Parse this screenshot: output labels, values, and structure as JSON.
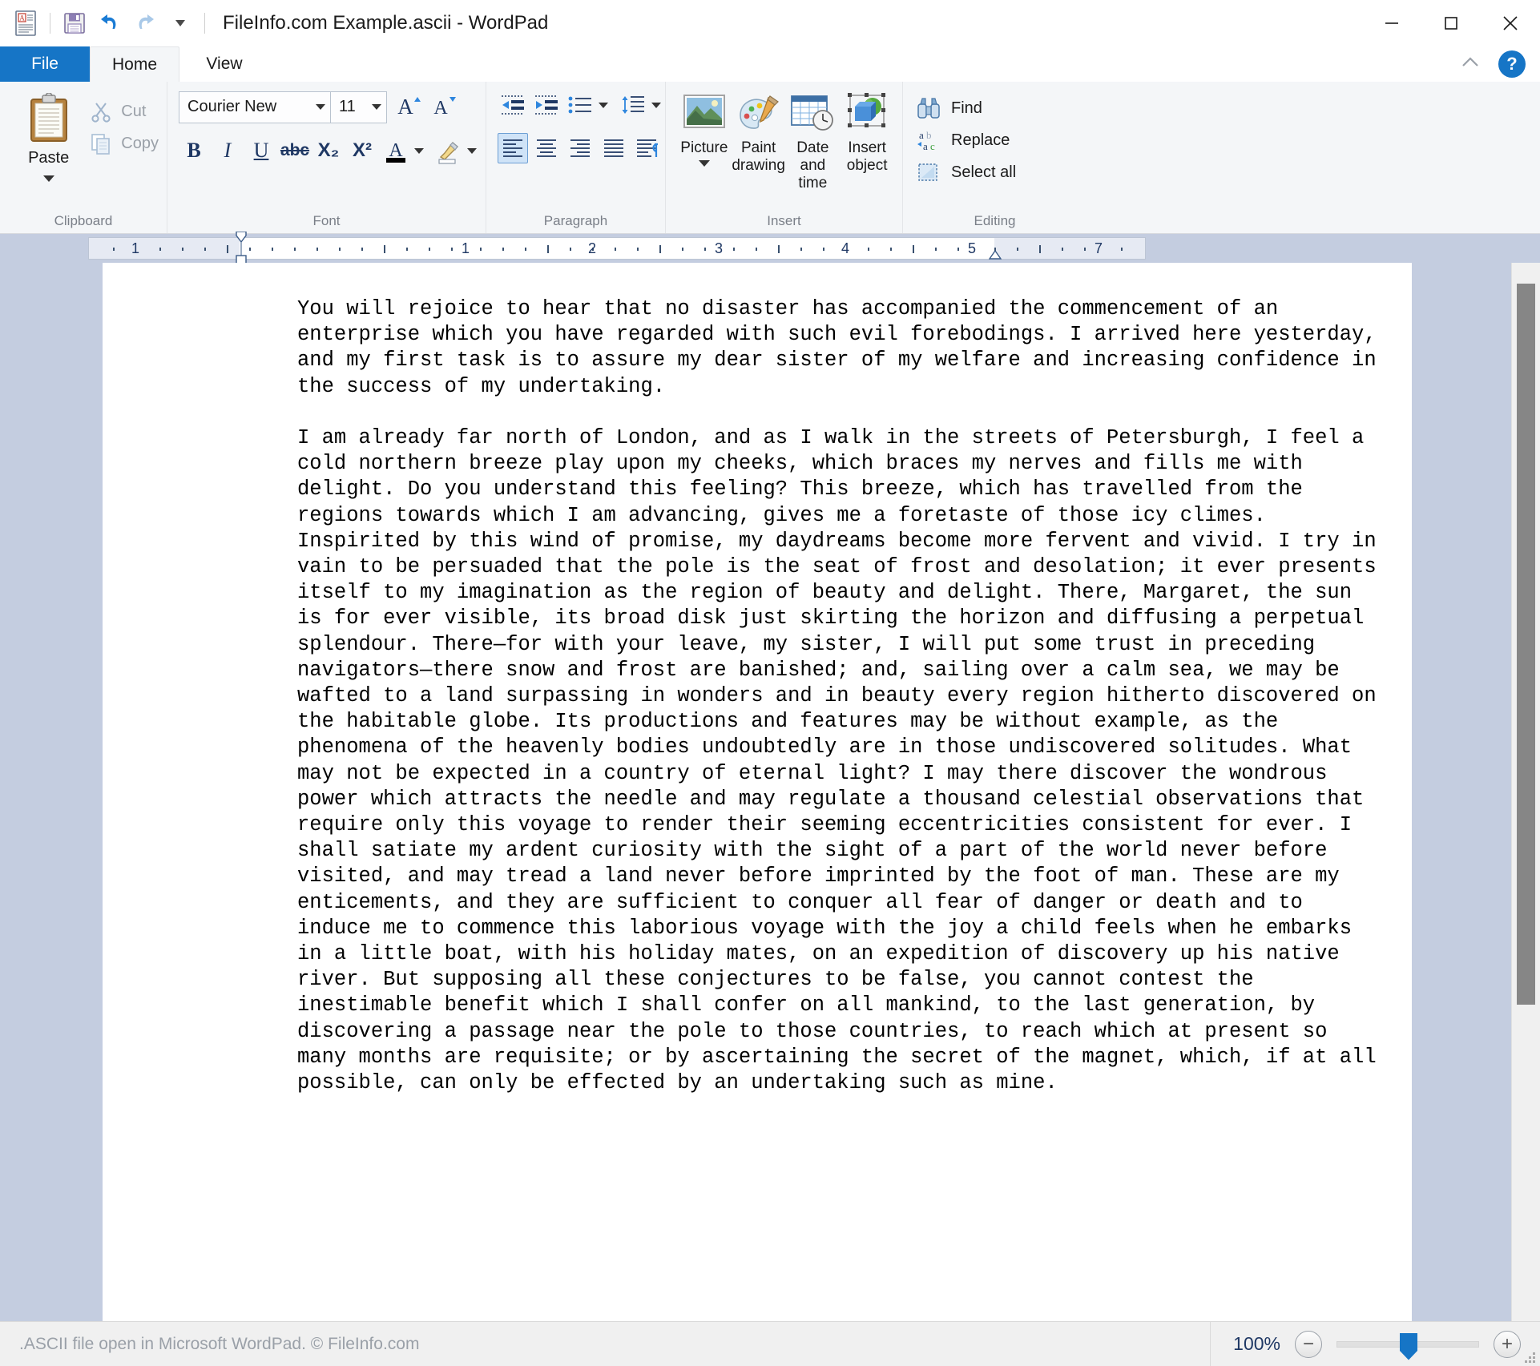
{
  "window": {
    "title": "FileInfo.com Example.ascii - WordPad",
    "app_icon": "document-app-icon",
    "minimize_label": "—",
    "maximize_label": "□",
    "close_label": "✕"
  },
  "quick_access": {
    "save_label": "save-icon",
    "undo_label": "undo-icon",
    "redo_label": "redo-icon",
    "customize_label": "▾"
  },
  "tabs": [
    {
      "label": "File",
      "active": false,
      "type": "file"
    },
    {
      "label": "Home",
      "active": true,
      "type": "normal"
    },
    {
      "label": "View",
      "active": false,
      "type": "normal"
    }
  ],
  "ribbon": {
    "collapse_label": "⌃",
    "help_label": "?",
    "groups": [
      {
        "name": "Clipboard",
        "label": "Clipboard",
        "paste": "Paste",
        "cut": "Cut",
        "copy": "Copy"
      },
      {
        "name": "Font",
        "label": "Font",
        "font_name": "Courier New",
        "font_size": "11",
        "grow_font": "A",
        "shrink_font": "A",
        "bold": "B",
        "italic": "I",
        "underline": "U",
        "strikethrough": "abc",
        "subscript": "X₂",
        "superscript": "X²",
        "text_color": "A",
        "highlight": "highlight-pen"
      },
      {
        "name": "Paragraph",
        "label": "Paragraph",
        "decrease_indent": "decrease-indent",
        "increase_indent": "increase-indent",
        "bullets": "bullets",
        "line_spacing": "line-spacing",
        "align_left": "align-left",
        "align_center": "align-center",
        "align_right": "align-right",
        "justify": "justify",
        "paragraph_marks": "paragraph-settings"
      },
      {
        "name": "Insert",
        "label": "Insert",
        "items": [
          {
            "label": "Picture",
            "icon": "picture-icon",
            "has_caret": true
          },
          {
            "label": "Paint\ndrawing",
            "icon": "paint-drawing-icon",
            "has_caret": false
          },
          {
            "label": "Date and\ntime",
            "icon": "date-time-icon",
            "has_caret": false
          },
          {
            "label": "Insert\nobject",
            "icon": "insert-object-icon",
            "has_caret": false
          }
        ]
      },
      {
        "name": "Editing",
        "label": "Editing",
        "find": "Find",
        "replace": "Replace",
        "select_all": "Select all"
      }
    ]
  },
  "ruler": {
    "numbers": [
      "1",
      "1",
      "2",
      "3",
      "4",
      "5",
      "7"
    ],
    "left_indent_marker": "first-line-indent-marker",
    "right_indent_marker": "right-indent-marker"
  },
  "document": {
    "paragraphs": [
      "You will rejoice to hear that no disaster has accompanied the commencement of an enterprise which you have regarded with such evil forebodings. I arrived here yesterday, and my first task is to assure my dear sister of my welfare and increasing confidence in the success of my undertaking.",
      "I am already far north of London, and as I walk in the streets of Petersburgh, I feel a cold northern breeze play upon my cheeks, which braces my nerves and fills me with delight. Do you understand this feeling? This breeze, which has travelled from the regions towards which I am advancing, gives me a foretaste of those icy climes. Inspirited by this wind of promise, my daydreams become more fervent and vivid. I try in vain to be persuaded that the pole is the seat of frost and desolation; it ever presents itself to my imagination as the region of beauty and delight. There, Margaret, the sun is for ever visible, its broad disk just skirting the horizon and diffusing a perpetual splendour. There—for with your leave, my sister, I will put some trust in preceding navigators—there snow and frost are banished; and, sailing over a calm sea, we may be wafted to a land surpassing in wonders and in beauty every region hitherto discovered on the habitable globe. Its productions and features may be without example, as the phenomena of the heavenly bodies undoubtedly are in those undiscovered solitudes. What may not be expected in a country of eternal light? I may there discover the wondrous power which attracts the needle and may regulate a thousand celestial observations that require only this voyage to render their seeming eccentricities consistent for ever. I shall satiate my ardent curiosity with the sight of a part of the world never before visited, and may tread a land never before imprinted by the foot of man. These are my enticements, and they are sufficient to conquer all fear of danger or death and to induce me to commence this laborious voyage with the joy a child feels when he embarks in a little boat, with his holiday mates, on an expedition of discovery up his native river. But supposing all these conjectures to be false, you cannot contest the inestimable benefit which I shall confer on all mankind, to the last generation, by discovering a passage near the pole to those countries, to reach which at present so many months are requisite; or by ascertaining the secret of the magnet, which, if at all possible, can only be effected by an undertaking such as mine."
    ]
  },
  "statusbar": {
    "text": ".ASCII file open in Microsoft WordPad. © FileInfo.com",
    "zoom_level": "100%",
    "zoom_out_label": "−",
    "zoom_in_label": "+"
  },
  "colors": {
    "accent": "#1675c6",
    "ribbon_bg": "#f4f6f8",
    "doc_bg": "#c4cde0",
    "icon_blue": "#1f3864"
  }
}
